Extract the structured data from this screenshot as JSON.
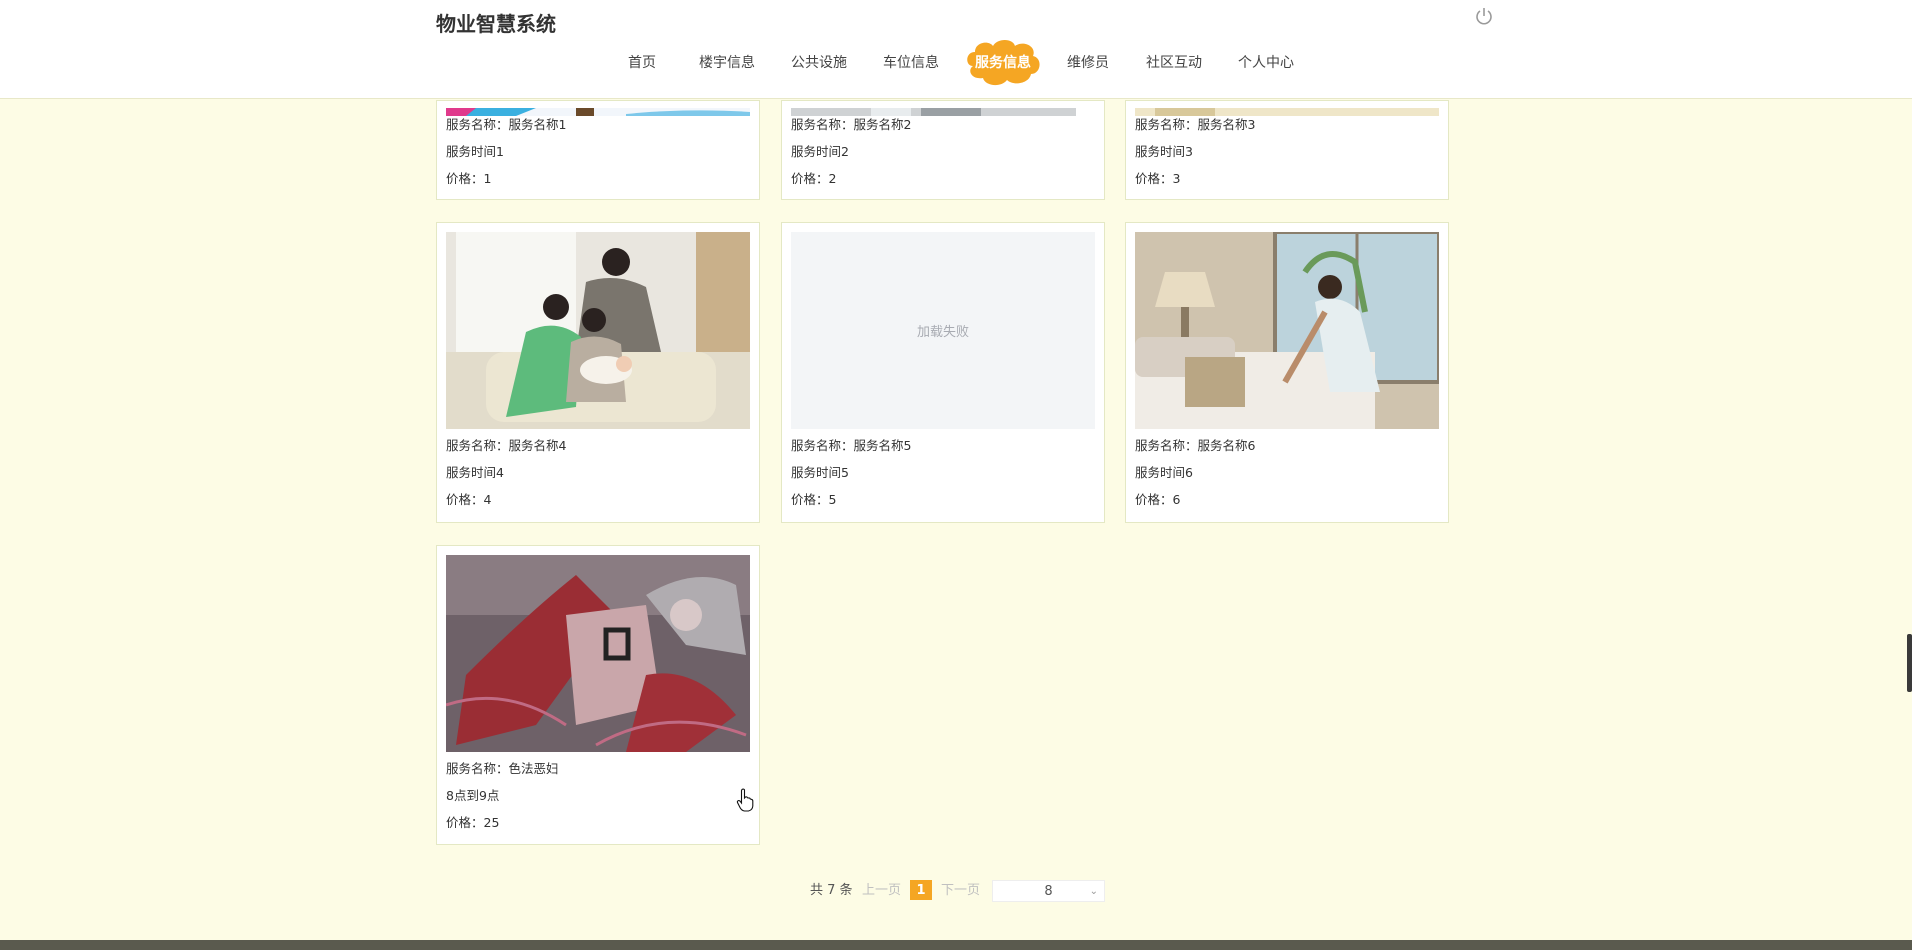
{
  "header": {
    "brand": "物业智慧系统",
    "nav": [
      "首页",
      "楼宇信息",
      "公共设施",
      "车位信息",
      "服务信息",
      "维修员",
      "社区互动",
      "个人中心"
    ],
    "active_index": 4,
    "accent": "#f5a623"
  },
  "cards": [
    {
      "name": "服务名称：服务名称1",
      "time": "服务时间1",
      "price": "价格：1",
      "image": "partial"
    },
    {
      "name": "服务名称：服务名称2",
      "time": "服务时间2",
      "price": "价格：2",
      "image": "partial"
    },
    {
      "name": "服务名称：服务名称3",
      "time": "服务时间3",
      "price": "价格：3",
      "image": "partial"
    },
    {
      "name": "服务名称：服务名称4",
      "time": "服务时间4",
      "price": "价格：4",
      "image": "family-with-nurse-photo"
    },
    {
      "name": "服务名称：服务名称5",
      "time": "服务时间5",
      "price": "价格：5",
      "image": "load-failed",
      "fail_text": "加载失败"
    },
    {
      "name": "服务名称：服务名称6",
      "time": "服务时间6",
      "price": "价格：6",
      "image": "housekeeper-making-bed-photo"
    },
    {
      "name": "服务名称：色法恶妇",
      "time": "8点到9点",
      "price": "价格：25",
      "image": "anime-character-illustration"
    }
  ],
  "pagination": {
    "total": "共 7 条",
    "prev": "上一页",
    "current": "1",
    "next": "下一页",
    "page_size": "8"
  }
}
